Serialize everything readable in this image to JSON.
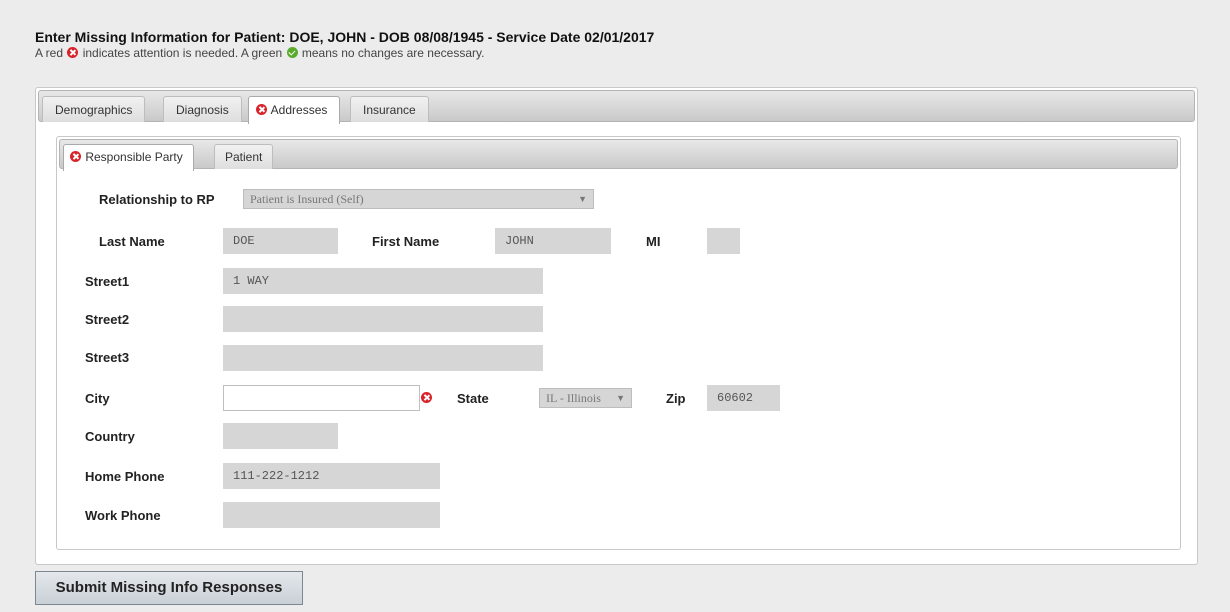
{
  "header": {
    "title": "Enter Missing Information for Patient: DOE, JOHN - DOB 08/08/1945 - Service Date 02/01/2017",
    "note_prefix": "A red",
    "note_middle": "indicates attention is needed. A green",
    "note_suffix": "means no changes are necessary."
  },
  "tabs": {
    "demographics": "Demographics",
    "diagnosis": "Diagnosis",
    "addresses": "Addresses",
    "insurance": "Insurance"
  },
  "subtabs": {
    "responsible_party": "Responsible Party",
    "patient": "Patient"
  },
  "form": {
    "relationship_label": "Relationship to RP",
    "relationship_value": "Patient is Insured (Self)",
    "last_name_label": "Last Name",
    "last_name_value": "DOE",
    "first_name_label": "First Name",
    "first_name_value": "JOHN",
    "mi_label": "MI",
    "mi_value": "",
    "street1_label": "Street1",
    "street1_value": "1 WAY",
    "street2_label": "Street2",
    "street2_value": "",
    "street3_label": "Street3",
    "street3_value": "",
    "city_label": "City",
    "city_value": "",
    "state_label": "State",
    "state_value": "IL - Illinois",
    "zip_label": "Zip",
    "zip_value": "60602",
    "country_label": "Country",
    "country_value": "",
    "home_phone_label": "Home Phone",
    "home_phone_value": "111-222-1212",
    "work_phone_label": "Work Phone",
    "work_phone_value": ""
  },
  "submit_label": "Submit Missing Info Responses",
  "icons": {
    "attention": "red-x-circle-icon",
    "ok": "green-check-circle-icon"
  },
  "colors": {
    "attention": "#d9232b",
    "ok": "#5aab2c"
  }
}
